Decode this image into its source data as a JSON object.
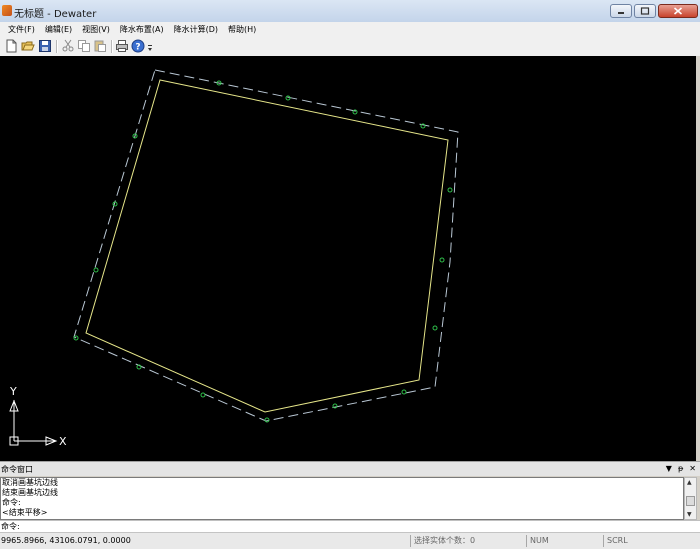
{
  "window": {
    "title": "无标题 - Dewater"
  },
  "menu": [
    {
      "label": "文件(F)"
    },
    {
      "label": "编辑(E)"
    },
    {
      "label": "视图(V)"
    },
    {
      "label": "降水布置(A)"
    },
    {
      "label": "降水计算(D)"
    },
    {
      "label": "帮助(H)"
    }
  ],
  "toolbar": {
    "icons": [
      "new-file-icon",
      "open-folder-icon",
      "save-icon",
      "cut-icon",
      "copy-icon",
      "paste-icon",
      "print-icon",
      "help-icon"
    ]
  },
  "canvas": {
    "background": "#000000",
    "boundary_color": "#e6e68a",
    "offset_color": "#b9c7d4",
    "marker_color": "#2fbf4a",
    "axis_color": "#ffffff",
    "axis_x_label": "X",
    "axis_y_label": "Y"
  },
  "command": {
    "panel_title": "命令窗口",
    "lines": [
      "取消画基坑边线",
      "结束画基坑边线",
      "命令:",
      "<结束平移>"
    ],
    "prompt": "命令:"
  },
  "status": {
    "coords": "9965.8966,  43106.0791,  0.0000",
    "entity_count": "选择实体个数：0",
    "num": "NUM",
    "scrl": "SCRL"
  }
}
